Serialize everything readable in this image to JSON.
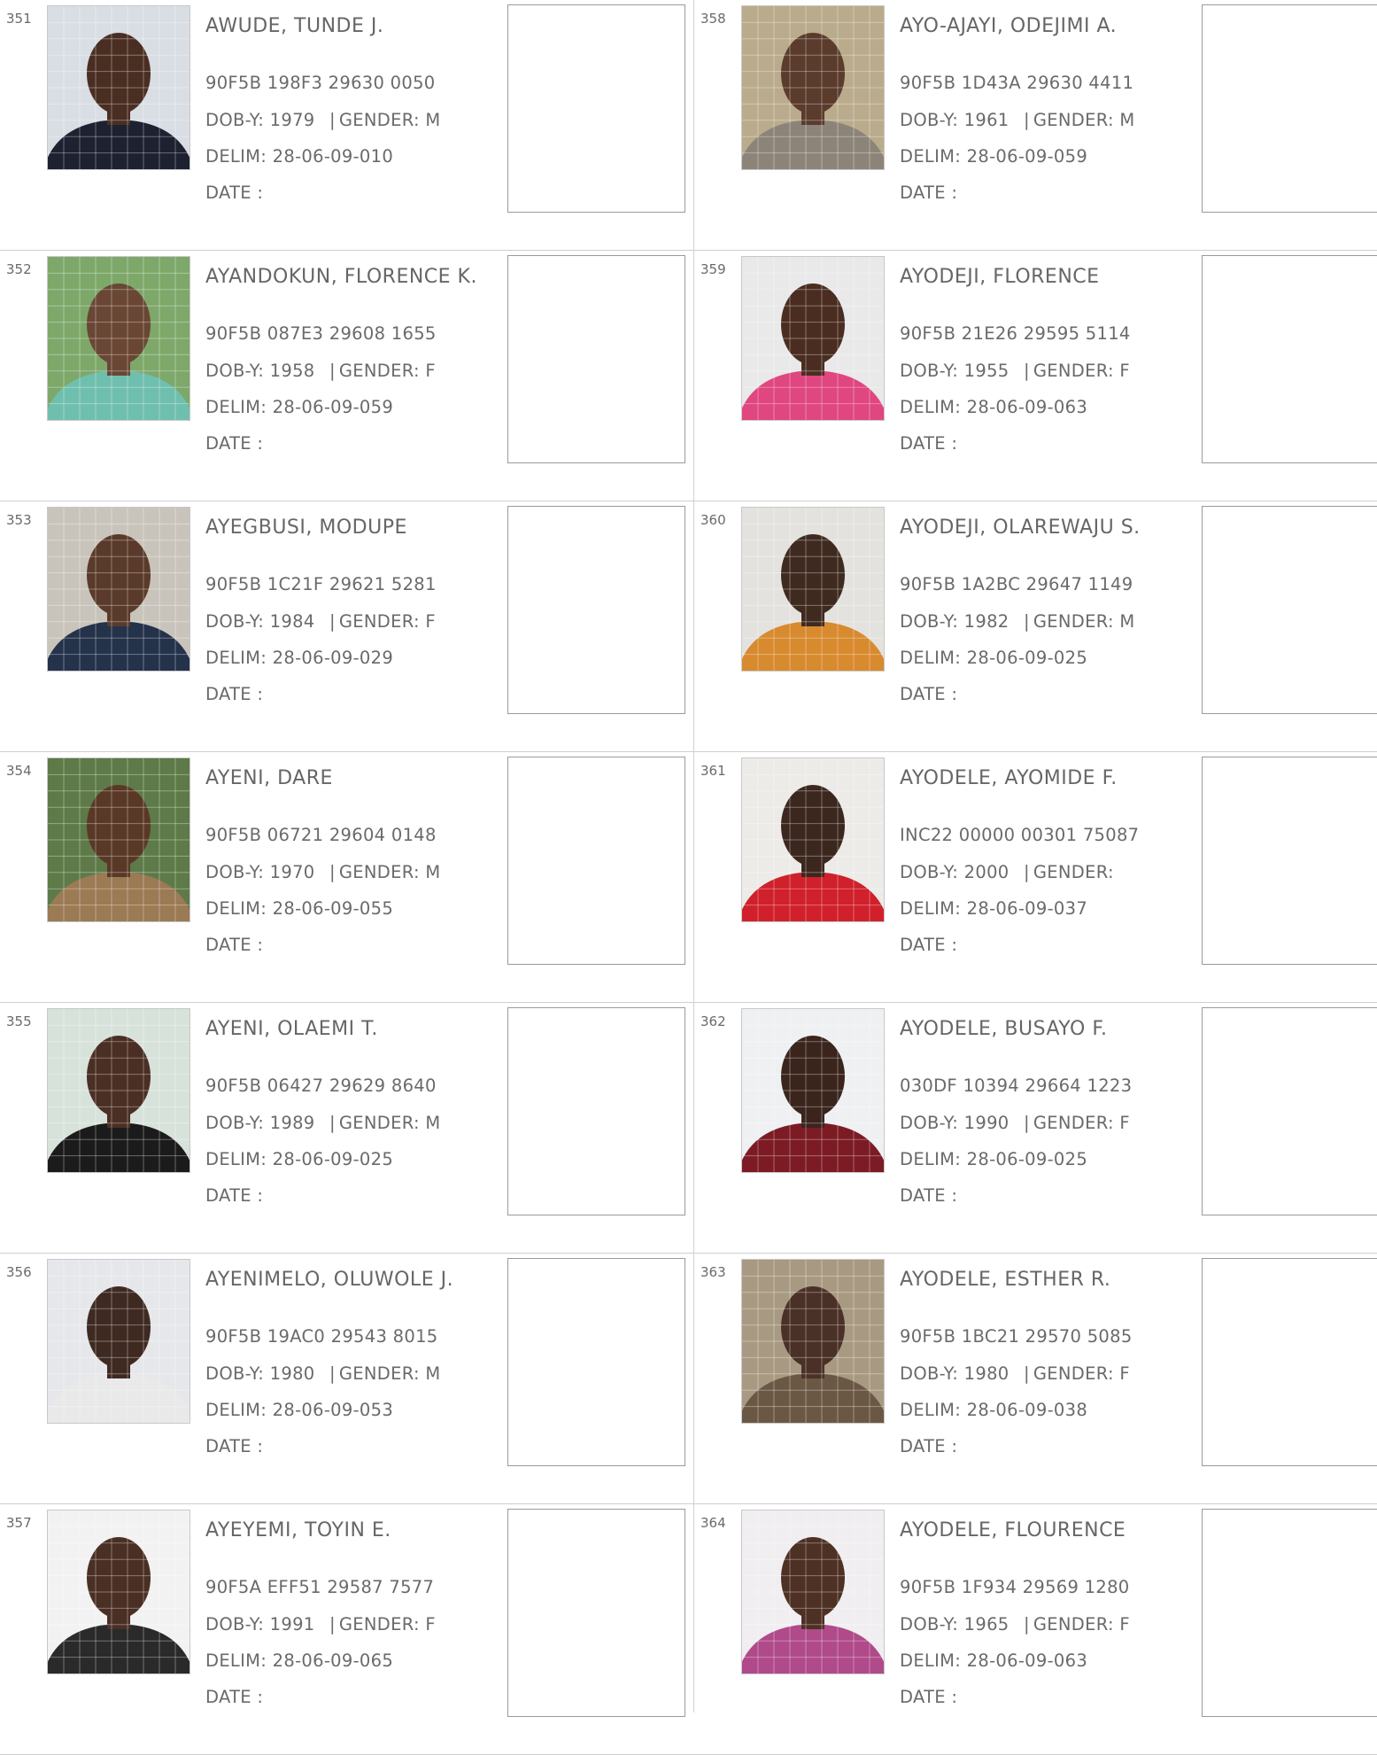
{
  "labels": {
    "dob": "DOB-Y:",
    "gender": "GENDER:",
    "delim": "DELIM:",
    "date": "DATE :"
  },
  "columns": [
    [
      {
        "serial": "351",
        "name": "AWUDE, TUNDE J.",
        "vin": "90F5B 198F3 29630 0050",
        "dob": "1979",
        "gender": "M",
        "delim": "28-06-09-010",
        "photo": {
          "bg": "#d9dde4",
          "skin": "#4a2e22",
          "cloth": "#1d2130"
        }
      },
      {
        "serial": "352",
        "name": "AYANDOKUN, FLORENCE K.",
        "vin": "90F5B 087E3 29608 1655",
        "dob": "1958",
        "gender": "F",
        "delim": "28-06-09-059",
        "photo": {
          "bg": "#7da86a",
          "skin": "#6a4634",
          "cloth": "#6fbfae"
        }
      },
      {
        "serial": "353",
        "name": "AYEGBUSI, MODUPE",
        "vin": "90F5B 1C21F 29621 5281",
        "dob": "1984",
        "gender": "F",
        "delim": "28-06-09-029",
        "photo": {
          "bg": "#c9c4bb",
          "skin": "#5a3a2a",
          "cloth": "#24324a"
        }
      },
      {
        "serial": "354",
        "name": "AYENI, DARE",
        "vin": "90F5B 06721 29604 0148",
        "dob": "1970",
        "gender": "M",
        "delim": "28-06-09-055",
        "photo": {
          "bg": "#5d7a48",
          "skin": "#5a3826",
          "cloth": "#9b7a54"
        }
      },
      {
        "serial": "355",
        "name": "AYENI, OLAEMI T.",
        "vin": "90F5B 06427 29629 8640",
        "dob": "1989",
        "gender": "M",
        "delim": "28-06-09-025",
        "photo": {
          "bg": "#d7e2da",
          "skin": "#4b2f24",
          "cloth": "#1b1b1b"
        }
      },
      {
        "serial": "356",
        "name": "AYENIMELO, OLUWOLE J.",
        "vin": "90F5B 19AC0 29543 8015",
        "dob": "1980",
        "gender": "M",
        "delim": "28-06-09-053",
        "photo": {
          "bg": "#e6e7ea",
          "skin": "#3f2a22",
          "cloth": "#e9e9e9"
        }
      },
      {
        "serial": "357",
        "name": "AYEYEMI, TOYIN E.",
        "vin": "90F5A EFF51 29587 7577",
        "dob": "1991",
        "gender": "F",
        "delim": "28-06-09-065",
        "photo": {
          "bg": "#f2f2f2",
          "skin": "#4a2f24",
          "cloth": "#2a2a2a"
        }
      }
    ],
    [
      {
        "serial": "358",
        "name": "AYO-AJAYI, ODEJIMI A.",
        "vin": "90F5B 1D43A 29630 4411",
        "dob": "1961",
        "gender": "M",
        "delim": "28-06-09-059",
        "photo": {
          "bg": "#b9ab8c",
          "skin": "#5a3b2c",
          "cloth": "#8c8478"
        }
      },
      {
        "serial": "359",
        "name": "AYODEJI, FLORENCE",
        "vin": "90F5B 21E26 29595 5114",
        "dob": "1955",
        "gender": "F",
        "delim": "28-06-09-063",
        "photo": {
          "bg": "#e9e9ea",
          "skin": "#4a2d20",
          "cloth": "#e0467f"
        }
      },
      {
        "serial": "360",
        "name": "AYODEJI, OLAREWAJU S.",
        "vin": "90F5B 1A2BC 29647 1149",
        "dob": "1982",
        "gender": "M",
        "delim": "28-06-09-025",
        "photo": {
          "bg": "#e4e2de",
          "skin": "#3f2a20",
          "cloth": "#d88a2e"
        }
      },
      {
        "serial": "361",
        "name": "AYODELE, AYOMIDE F.",
        "vin": "INC22 00000 00301 75087",
        "dob": "2000",
        "gender": "",
        "delim": "28-06-09-037",
        "photo": {
          "bg": "#ecebe8",
          "skin": "#3b271e",
          "cloth": "#d0202b"
        }
      },
      {
        "serial": "362",
        "name": "AYODELE, BUSAYO F.",
        "vin": "030DF 10394 29664 1223",
        "dob": "1990",
        "gender": "F",
        "delim": "28-06-09-025",
        "photo": {
          "bg": "#eef0f2",
          "skin": "#3a241c",
          "cloth": "#7c1b24"
        }
      },
      {
        "serial": "363",
        "name": "AYODELE, ESTHER R.",
        "vin": "90F5B 1BC21 29570 5085",
        "dob": "1980",
        "gender": "F",
        "delim": "28-06-09-038",
        "photo": {
          "bg": "#a89a82",
          "skin": "#4a3026",
          "cloth": "#6b5844"
        }
      },
      {
        "serial": "364",
        "name": "AYODELE, FLOURENCE",
        "vin": "90F5B 1F934 29569 1280",
        "dob": "1965",
        "gender": "F",
        "delim": "28-06-09-063",
        "photo": {
          "bg": "#f0eef0",
          "skin": "#4e3024",
          "cloth": "#b04a8a"
        }
      }
    ]
  ]
}
